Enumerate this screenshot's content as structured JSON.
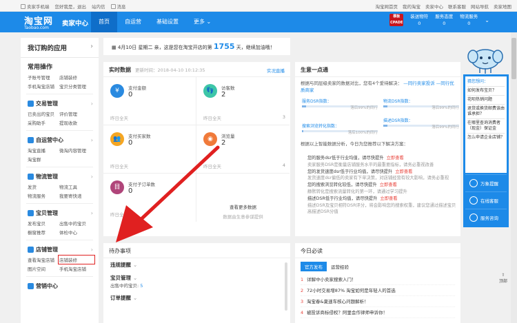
{
  "topbar": {
    "left": [
      "卖家手机端",
      "您好我是，退出",
      "站内信",
      "消息"
    ],
    "right": [
      "淘宝网首页",
      "我的淘宝",
      "卖家中心",
      "联系客服",
      "网站导航",
      "卖家地图"
    ]
  },
  "header": {
    "logo_cn": "淘宝网",
    "logo_en": "Taobao.com",
    "center": "卖家中心",
    "nav": [
      "首页",
      "自运营",
      "基础设置",
      "更多"
    ],
    "badge_top": "模板",
    "badge_bottom": "CPADE",
    "stats": [
      {
        "label": "装送物符",
        "value": "0"
      },
      {
        "label": "服务态度",
        "value": "0"
      },
      {
        "label": "物流服务",
        "value": "0"
      }
    ]
  },
  "sidebar": {
    "title": "我订购的应用",
    "common_title": "常用操作",
    "common": [
      "子账号管理",
      "店铺装修",
      "手机淘宝店铺",
      "宝贝分类管理"
    ],
    "sections": [
      {
        "title": "交易管理",
        "items": [
          "已卖出的宝贝",
          "评价管理",
          "采购助手",
          "提现收款"
        ]
      },
      {
        "title": "自运营中心",
        "items": [
          "淘宝直播",
          "微淘内容管理",
          "淘宝群"
        ]
      },
      {
        "title": "物流管理",
        "items": [
          "发货",
          "物流工具",
          "物流服务",
          "我要寄快递"
        ]
      },
      {
        "title": "宝贝管理",
        "items": [
          "发布宝贝",
          "出售中的宝贝",
          "橱窗推荐",
          "体检中心"
        ]
      },
      {
        "title": "店铺管理",
        "items": [
          "查看淘宝店铺",
          "店铺装修",
          "图片空间",
          "手机淘宝店铺"
        ]
      },
      {
        "title": "营销中心",
        "items": []
      }
    ]
  },
  "announce": {
    "text1": "4月10日 星期二 亲，这是您在淘宝开店的第",
    "days": "1755",
    "text2": "天，继续加油哦！"
  },
  "realtime": {
    "title": "实时数据",
    "updated": "更新时间：2018-04-10 10:12:35",
    "link": "实况直播",
    "cells": [
      {
        "label": "支付金额",
        "value": "0",
        "foot": "昨日全天",
        "num": "",
        "color": "#2a8ae0",
        "icon": "¥"
      },
      {
        "label": "访客数",
        "value": "2",
        "foot": "昨日全天",
        "num": "3",
        "color": "#3ec6a8",
        "icon": "👣"
      },
      {
        "label": "支付买家数",
        "value": "0",
        "foot": "昨日全天",
        "num": "",
        "color": "#f5a623",
        "icon": "👥"
      },
      {
        "label": "浏览量",
        "value": "2",
        "foot": "昨日全天",
        "num": "4",
        "color": "#f07a3a",
        "icon": "◉"
      },
      {
        "label": "支付子订单数",
        "value": "0",
        "foot": "昨日全天",
        "num": "",
        "color": "#b0457a",
        "icon": "目"
      }
    ],
    "more_title": "查看更多数据",
    "more_desc": "数据由生意参谋提供"
  },
  "business": {
    "title": "生意一点通",
    "intro": "根据与同层级卖家的数据对比，您有4个爱待解决：",
    "intro_link1": "—同行卖家投诉",
    "intro_link2": "—同行优质商家",
    "meters": [
      {
        "label": "服务DSR指数：",
        "note": "落后99%的同行",
        "fill": 0.05
      },
      {
        "label": "物流DSR指数：",
        "note": "落后99%的同行",
        "fill": 0.05
      },
      {
        "label": "描述DSR指数：",
        "note": "落后99%的同行",
        "fill": 0.05
      },
      {
        "label": "搜索浏览转化指数：",
        "note": "落后100%的同行",
        "fill": 0.02
      }
    ],
    "lead": "根据以上智能数据分析，今日为您推荐以下解决方案：",
    "tips": [
      {
        "t": "您的服务dsr低于行业均值，请尽快提升",
        "a": "立即查看",
        "d": "卖家服务DSR是衡量店铺服务水平的最重要指标，请务必重视改善"
      },
      {
        "t": "您的发货速度dsr低于行业均值，请尽快提升",
        "a": "立即查看",
        "d": "发货速度dsr偏低的卖家有下单决策，对店铺经营有较大影响，请务必重视"
      },
      {
        "t": "您的搜索浏览转化较低，请尽快提升",
        "a": "立即查看",
        "d": "静默转化是搜索流量转化的第一环，请通过学习提升"
      },
      {
        "t": "描述DSR低于行业均值，请尽快提升",
        "a": "立即查看",
        "d": "描述DSR及宝贝相符DSR评分，将会影响您的搜索权重，建议您通过描述宝贝"
      },
      {
        "t": "",
        "a": "",
        "d": "高描述DSR分值"
      }
    ]
  },
  "todo": {
    "title": "待办事项",
    "rows": [
      "违规提醒",
      "宝贝管理",
      "订单提醒"
    ],
    "sub_label": "出售中的宝贝:",
    "sub_value": "5"
  },
  "mustread": {
    "title": "今日必读",
    "tabs": [
      "官方发布",
      "运营经验"
    ],
    "news": [
      "详解中小卖家搜索入门！",
      "72小时交易增87% 淘宝如何是年轻人的首选",
      "淘宝春&夏速车核心问题解析！",
      "被投诉商标侵权？阿里会作律师申诉你！"
    ]
  },
  "help": {
    "questions": [
      "猜您想问：",
      "如何发布宝贝？",
      "花呗热销问题",
      "退货或换货邮费该由谁承担？",
      "在哪里查询消费者（现金）保证金",
      "怎么申请企业店铺？"
    ],
    "buttons": [
      "万象提醒",
      "在线客服",
      "服务咨询"
    ]
  },
  "backtop": "顶部"
}
